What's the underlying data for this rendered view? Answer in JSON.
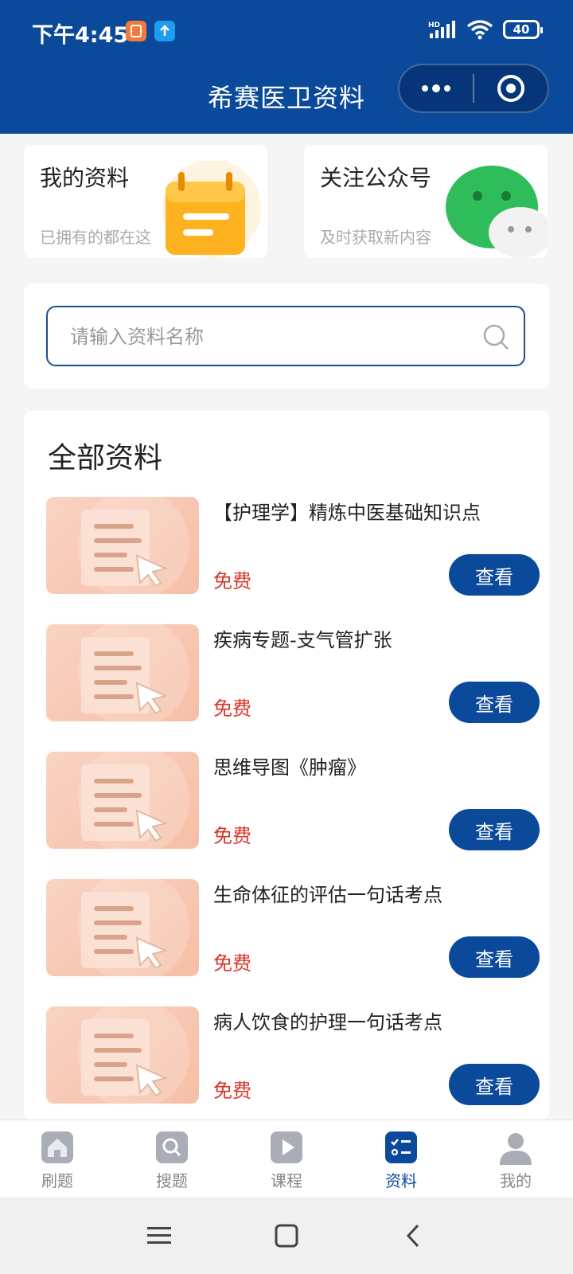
{
  "status_bar": {
    "time": "下午4:45",
    "battery": "40"
  },
  "header": {
    "title": "希赛医卫资料"
  },
  "cards": {
    "my_materials": {
      "title": "我的资料",
      "subtitle": "已拥有的都在这"
    },
    "follow": {
      "title": "关注公众号",
      "subtitle": "及时获取新内容"
    }
  },
  "search": {
    "placeholder": "请输入资料名称"
  },
  "section": {
    "title": "全部资料"
  },
  "items": [
    {
      "title": "【护理学】精炼中医基础知识点",
      "price": "免费",
      "action": "查看"
    },
    {
      "title": "疾病专题-支气管扩张",
      "price": "免费",
      "action": "查看"
    },
    {
      "title": "思维导图《肿瘤》",
      "price": "免费",
      "action": "查看"
    },
    {
      "title": "生命体征的评估一句话考点",
      "price": "免费",
      "action": "查看"
    },
    {
      "title": "病人饮食的护理一句话考点",
      "price": "免费",
      "action": "查看"
    }
  ],
  "tabs": [
    {
      "label": "刷题",
      "icon": "home-icon"
    },
    {
      "label": "搜题",
      "icon": "search-icon"
    },
    {
      "label": "课程",
      "icon": "play-icon"
    },
    {
      "label": "资料",
      "icon": "checklist-icon",
      "active": true
    },
    {
      "label": "我的",
      "icon": "user-icon"
    }
  ],
  "colors": {
    "brand": "#0b4a9b",
    "price": "#d8352b"
  }
}
